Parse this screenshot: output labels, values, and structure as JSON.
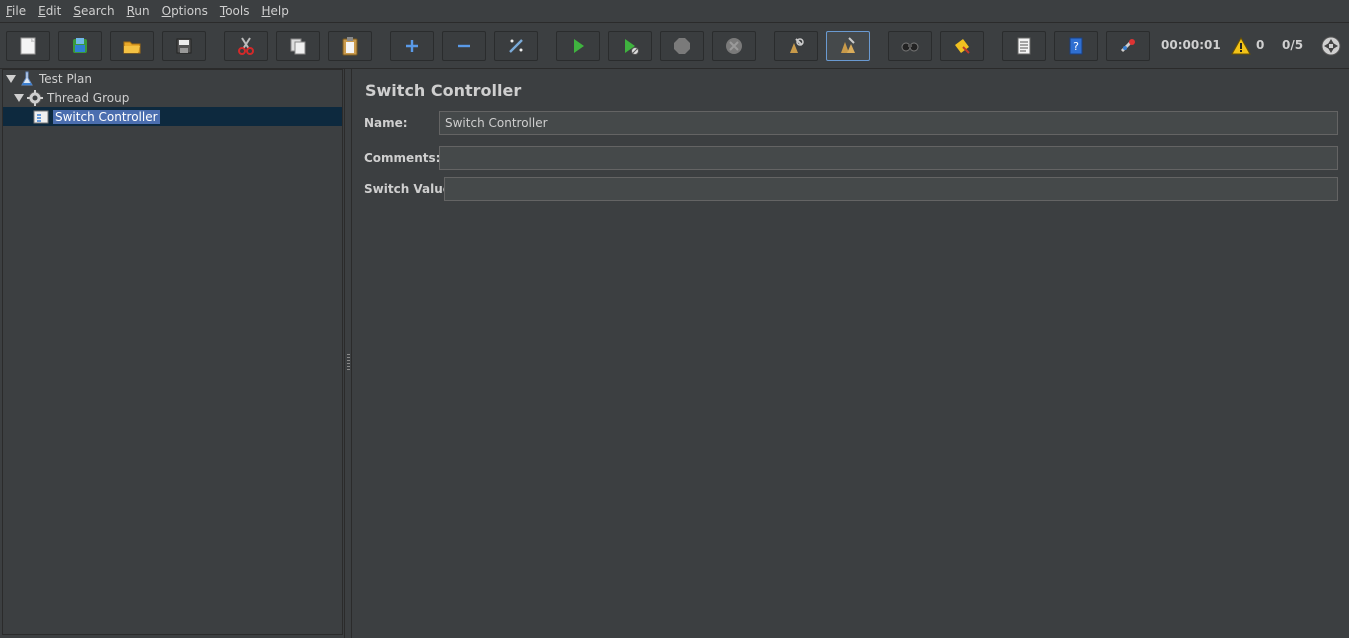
{
  "menu": [
    {
      "mnemonic": "F",
      "rest": "ile"
    },
    {
      "mnemonic": "E",
      "rest": "dit"
    },
    {
      "mnemonic": "S",
      "rest": "earch"
    },
    {
      "mnemonic": "R",
      "rest": "un"
    },
    {
      "mnemonic": "O",
      "rest": "ptions"
    },
    {
      "mnemonic": "T",
      "rest": "ools"
    },
    {
      "mnemonic": "H",
      "rest": "elp"
    }
  ],
  "toolbar": {
    "elapsed_time": "00:00:01",
    "warning_count": "0",
    "threads_ratio": "0/5",
    "icons": [
      "new-icon",
      "templates-icon",
      "open-icon",
      "save-icon",
      "cut-icon",
      "copy-icon",
      "paste-icon",
      "expand-icon",
      "collapse-icon",
      "toggle-icon",
      "start-icon",
      "start-no-pause-icon",
      "stop-icon",
      "shutdown-icon",
      "clear-icon",
      "clear-all-icon",
      "search-icon",
      "reset-search-icon",
      "function-helper-icon",
      "help-icon",
      "remote-icon"
    ]
  },
  "tree": {
    "items": [
      {
        "label": "Test Plan",
        "icon": "test-plan-icon"
      },
      {
        "label": "Thread Group",
        "icon": "thread-group-icon"
      },
      {
        "label": "Switch Controller",
        "icon": "switch-controller-icon",
        "selected": true
      }
    ]
  },
  "panel": {
    "title": "Switch Controller",
    "name_label": "Name:",
    "name_value": "Switch Controller",
    "comments_label": "Comments:",
    "comments_value": "",
    "switch_label": "Switch Value",
    "switch_value": ""
  },
  "colors": {
    "background": "#3c3f41",
    "selection": "#4b6eaf",
    "selection_row": "#0d293e"
  }
}
